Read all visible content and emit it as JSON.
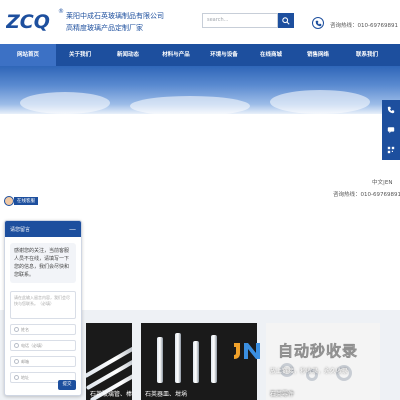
{
  "header": {
    "logo_text": "ZCQ",
    "logo_reg": "®",
    "company_name": "莱阳中成石英玻璃制品有限公司",
    "tagline": "高精度玻璃产品定制厂家",
    "search_placeholder": "search...",
    "hotline": "咨询热线：010-69769891",
    "search_icon": "search-icon",
    "phone_icon": "phone-icon"
  },
  "nav": {
    "items": [
      {
        "label": "网站首页",
        "active": true
      },
      {
        "label": "关于我们",
        "active": false
      },
      {
        "label": "新闻动态",
        "active": false
      },
      {
        "label": "材料与产品",
        "active": false
      },
      {
        "label": "环境与设备",
        "active": false
      },
      {
        "label": "在线商城",
        "active": false
      },
      {
        "label": "销售网络",
        "active": false
      },
      {
        "label": "联系我们",
        "active": false
      }
    ],
    "color": "#1d4f9e"
  },
  "side": {
    "language": "中文|EN",
    "hotline": "咨询热线：010-69769891"
  },
  "service": {
    "tag": "在线客服"
  },
  "chat": {
    "title": "请您留言",
    "minimize": "—",
    "message": "感谢您的关注，当前客服人员不在线，请填写一下您的信息，我们会尽快和您联系。",
    "textarea_placeholder": "请在此输入留言内容，我们会尽快与您联系。（必填）",
    "fields": [
      {
        "placeholder": "姓名",
        "icon": "user-icon"
      },
      {
        "placeholder": "电话（必填）",
        "icon": "phone-icon"
      },
      {
        "placeholder": "邮箱",
        "icon": "mail-icon"
      },
      {
        "placeholder": "地址",
        "icon": "location-icon"
      }
    ],
    "submit": "提交"
  },
  "products": [
    {
      "label": "石英玻璃管、棒"
    },
    {
      "label": "石英器皿、坩埚"
    },
    {
      "label": "石英零件"
    }
  ],
  "watermark": {
    "title": "自动秒收录",
    "slogan": "放上链接，秒收录，永久收录"
  }
}
